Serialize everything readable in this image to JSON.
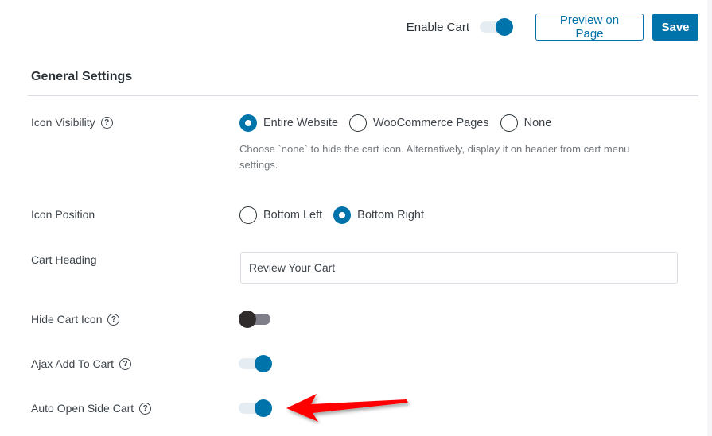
{
  "header": {
    "enable_cart_label": "Enable Cart",
    "enable_cart_on": true,
    "preview_label": "Preview on Page",
    "save_label": "Save"
  },
  "section": {
    "title": "General Settings"
  },
  "settings": {
    "icon_visibility": {
      "label": "Icon Visibility",
      "options": [
        "Entire Website",
        "WooCommerce Pages",
        "None"
      ],
      "selected": "Entire Website",
      "description": "Choose `none` to hide the cart icon. Alternatively, display it on header from cart menu settings."
    },
    "icon_position": {
      "label": "Icon Position",
      "options": [
        "Bottom Left",
        "Bottom Right"
      ],
      "selected": "Bottom Right"
    },
    "cart_heading": {
      "label": "Cart Heading",
      "value": "Review Your Cart"
    },
    "hide_cart_icon": {
      "label": "Hide Cart Icon",
      "on": false
    },
    "ajax_add_to_cart": {
      "label": "Ajax Add To Cart",
      "on": true
    },
    "auto_open_side_cart": {
      "label": "Auto Open Side Cart",
      "on": true
    }
  },
  "help_glyph": "?",
  "colors": {
    "accent": "#0073aa",
    "annotation_arrow": "#ff0000"
  }
}
